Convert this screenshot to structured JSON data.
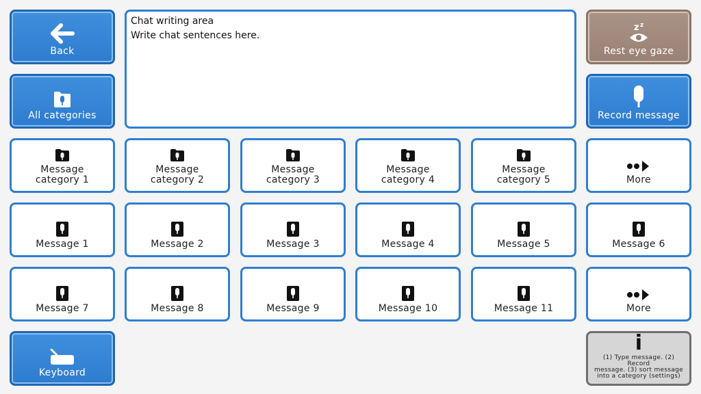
{
  "nav": {
    "back_label": "Back",
    "all_categories_label": "All categories",
    "keyboard_label": "Keyboard",
    "rest_eye_gaze_label": "Rest eye gaze",
    "record_message_label": "Record message"
  },
  "chat": {
    "text": "Chat writing area\nWrite chat sentences here."
  },
  "categories": [
    {
      "label": "Message\ncategory 1"
    },
    {
      "label": "Message\ncategory 2"
    },
    {
      "label": "Message\ncategory 3"
    },
    {
      "label": "Message\ncategory 4"
    },
    {
      "label": "Message\ncategory 5"
    }
  ],
  "more_labels": [
    "More",
    "More"
  ],
  "messages": [
    {
      "label": "Message 1"
    },
    {
      "label": "Message 2"
    },
    {
      "label": "Message 3"
    },
    {
      "label": "Message 4"
    },
    {
      "label": "Message 5"
    },
    {
      "label": "Message 6"
    },
    {
      "label": "Message 7"
    },
    {
      "label": "Message 8"
    },
    {
      "label": "Message 9"
    },
    {
      "label": "Message 10"
    },
    {
      "label": "Message 11"
    }
  ],
  "info": {
    "icon": "i",
    "text": "(1) Type message. (2) Record\nmessage. (3) sort message\ninto a category (settings)"
  },
  "colors": {
    "blue_tile": "#2e7ccf",
    "tile_border": "#2f7fd0",
    "rest_tile": "#9a8175",
    "info_tile": "#d6d6d6",
    "background": "#f4f4f4"
  },
  "icons": {
    "back": "arrow-left-icon",
    "category": "folder-microphone-icon",
    "message": "microphone-icon",
    "more": "more-arrow-icon",
    "rest": "sleep-eye-icon",
    "record": "microphone-icon",
    "keyboard": "keyboard-icon",
    "info": "info-icon"
  }
}
